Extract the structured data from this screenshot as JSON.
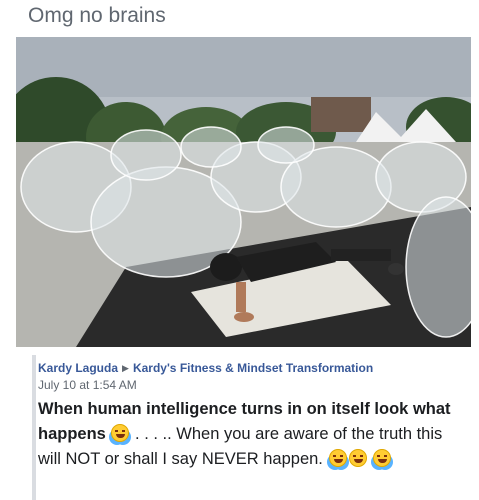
{
  "caption": "Omg no brains",
  "post": {
    "author": "Kardy Laguda",
    "group": "Kardy's Fitness & Mindset Transformation",
    "timestamp": "July 10 at 1:54 AM",
    "text_bold": "When human intelligence turns in on itself  look what happens",
    "text_dots": " . . . .. ",
    "text_rest": "When you are aware of the truth this will NOT or shall I say NEVER happen.",
    "icons": {
      "share_arrow": "triangle-right-icon",
      "emoji_laughing": "rolling-laughing-emoji-icon",
      "emoji_grinning_sweat": "grinning-sweat-emoji-icon"
    }
  },
  "photo": {
    "description_icon": "photo-image"
  },
  "colors": {
    "link": "#385898",
    "meta": "#606770",
    "text": "#1c1e21",
    "quote_bar": "#d9dce1"
  }
}
